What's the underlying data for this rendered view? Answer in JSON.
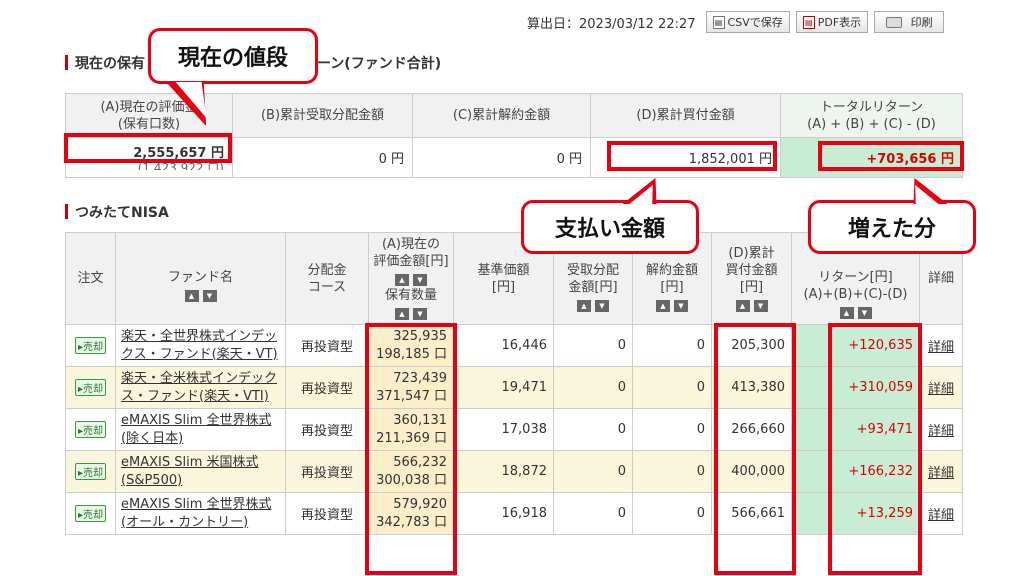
{
  "toolbar": {
    "calc_date": "算出日：2023/03/12 22:27",
    "csv_label": "CSVで保存",
    "pdf_label": "PDF表示",
    "print_label": "印刷"
  },
  "summary": {
    "section_title": "現在の保有",
    "section_title_tail": "ーン(ファンド合計)",
    "headers": {
      "a1": "(A)現在の評価金",
      "a2": "(保有口数)",
      "b": "(B)累計受取分配金額",
      "c": "(C)累計解約金額",
      "d": "(D)累計買付金額",
      "tr1": "トータルリターン",
      "tr2": "(A) + (B) + (C) - (D)"
    },
    "values": {
      "a": "2,555,657 円",
      "a_units": "(1,423,922 口)",
      "b": "0 円",
      "c": "0 円",
      "d": "1,852,001 円",
      "tr": "+703,656 円"
    }
  },
  "nisa": {
    "section_title": "つみたてNISA",
    "headers": {
      "order": "注文",
      "fund": "ファンド名",
      "dist1": "分配金",
      "dist2": "コース",
      "a1": "(A)現在の",
      "a2": "評価金額[円]",
      "a3": "保有数量",
      "base1": "基準価額",
      "base2": "[円]",
      "b1": "受取分配",
      "b2": "金額[円]",
      "c1": "解約金額",
      "c2": "[円]",
      "d1": "(D)累計",
      "d2": "買付金額",
      "d3": "[円]",
      "ret1": "リターン[円]",
      "ret2": "(A)+(B)+(C)-(D)",
      "detail": "詳細"
    },
    "sell_label": "売却",
    "detail_label": "詳細",
    "rows": [
      {
        "name": "楽天・全世界株式インデックス・ファンド(楽天・VT)",
        "course": "再投資型",
        "value": "325,935",
        "units": "198,185 口",
        "base": "16,446",
        "b": "0",
        "c": "0",
        "d": "205,300",
        "ret": "+120,635"
      },
      {
        "name": "楽天・全米株式インデックス・ファンド(楽天・VTI)",
        "course": "再投資型",
        "value": "723,439",
        "units": "371,547 口",
        "base": "19,471",
        "b": "0",
        "c": "0",
        "d": "413,380",
        "ret": "+310,059"
      },
      {
        "name": "eMAXIS Slim 全世界株式(除く日本)",
        "course": "再投資型",
        "value": "360,131",
        "units": "211,369 口",
        "base": "17,038",
        "b": "0",
        "c": "0",
        "d": "266,660",
        "ret": "+93,471"
      },
      {
        "name": "eMAXIS Slim 米国株式(S&P500)",
        "course": "再投資型",
        "value": "566,232",
        "units": "300,038 口",
        "base": "18,872",
        "b": "0",
        "c": "0",
        "d": "400,000",
        "ret": "+166,232"
      },
      {
        "name": "eMAXIS Slim 全世界株式(オール・カントリー)",
        "course": "再投資型",
        "value": "579,920",
        "units": "342,783 口",
        "base": "16,918",
        "b": "0",
        "c": "0",
        "d": "566,661",
        "ret": "+13,259"
      }
    ]
  },
  "callouts": {
    "current": "現在の値段",
    "paid": "支払い金額",
    "gain": "増えた分"
  },
  "colors": {
    "accent_red": "#e60012",
    "return_green": "#c9ecd5",
    "row_alt": "#faf6dc"
  }
}
